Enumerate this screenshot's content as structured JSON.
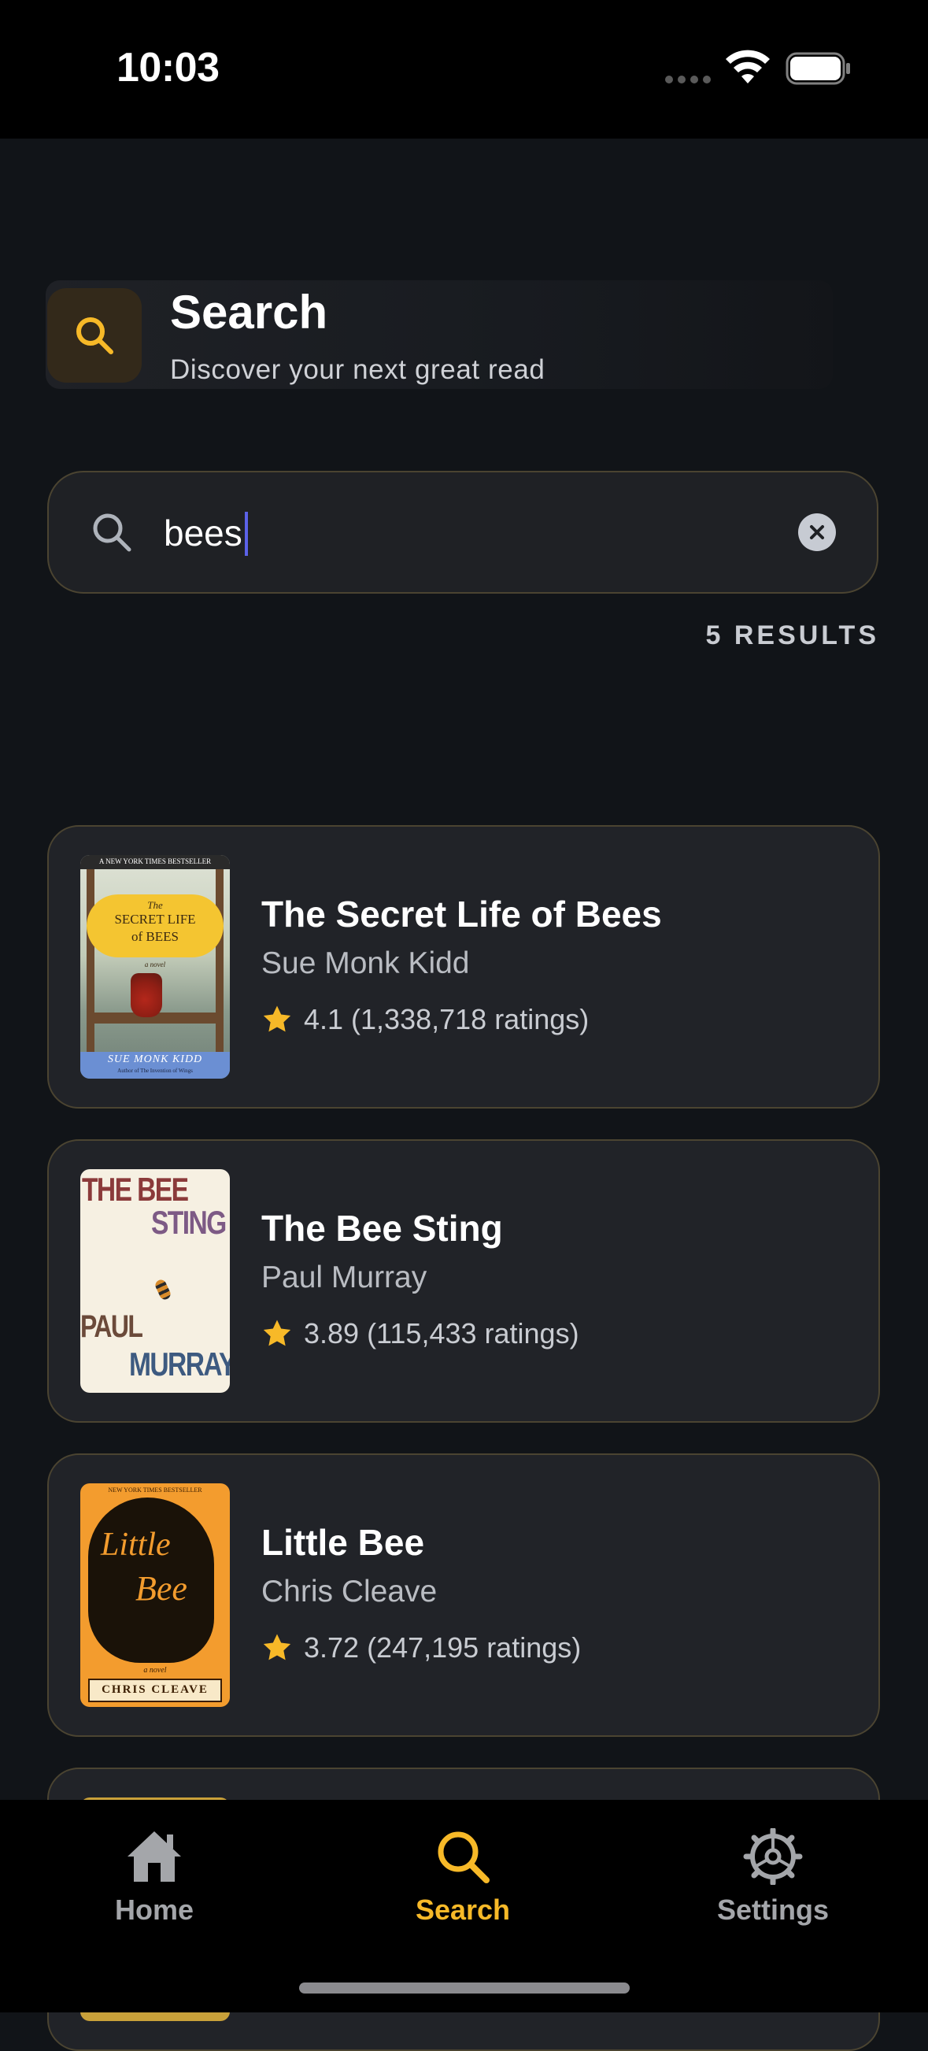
{
  "status_bar": {
    "time": "10:03"
  },
  "header": {
    "title": "Search",
    "subtitle": "Discover your next great read",
    "icon": "search-icon"
  },
  "search": {
    "query": "bees",
    "placeholder": ""
  },
  "results": {
    "count_label": "5 RESULTS",
    "items": [
      {
        "title": "The Secret Life of Bees",
        "author": "Sue Monk Kidd",
        "rating": "4.1 (1,338,718 ratings)",
        "cover": {
          "banner": "A NEW YORK TIMES BESTSELLER",
          "line1": "The",
          "line2": "SECRET LIFE",
          "line3": "of BEES",
          "tag": "a novel",
          "author": "SUE MONK KIDD",
          "footer": "Author of The Invention of Wings"
        }
      },
      {
        "title": "The Bee Sting",
        "author": "Paul Murray",
        "rating": "3.89 (115,433 ratings)",
        "cover": {
          "line1": "THE BEE",
          "line2": "STING",
          "line3": "PAUL",
          "line4": "MURRAY"
        }
      },
      {
        "title": "Little Bee",
        "author": "Chris Cleave",
        "rating": "3.72 (247,195 ratings)",
        "cover": {
          "banner": "NEW YORK TIMES BESTSELLER",
          "line1": "Little",
          "line2": "Bee",
          "tag": "a novel",
          "author": "CHRIS CLEAVE"
        }
      }
    ]
  },
  "tab_bar": {
    "tabs": [
      {
        "label": "Home",
        "icon": "home-icon"
      },
      {
        "label": "Search",
        "icon": "search-icon"
      },
      {
        "label": "Settings",
        "icon": "gear-icon"
      }
    ],
    "active": "Search"
  },
  "colors": {
    "accent": "#f7b928",
    "background": "#111418",
    "card": "#212328",
    "card_border": "#4b4431",
    "caret": "#5b62e8"
  }
}
